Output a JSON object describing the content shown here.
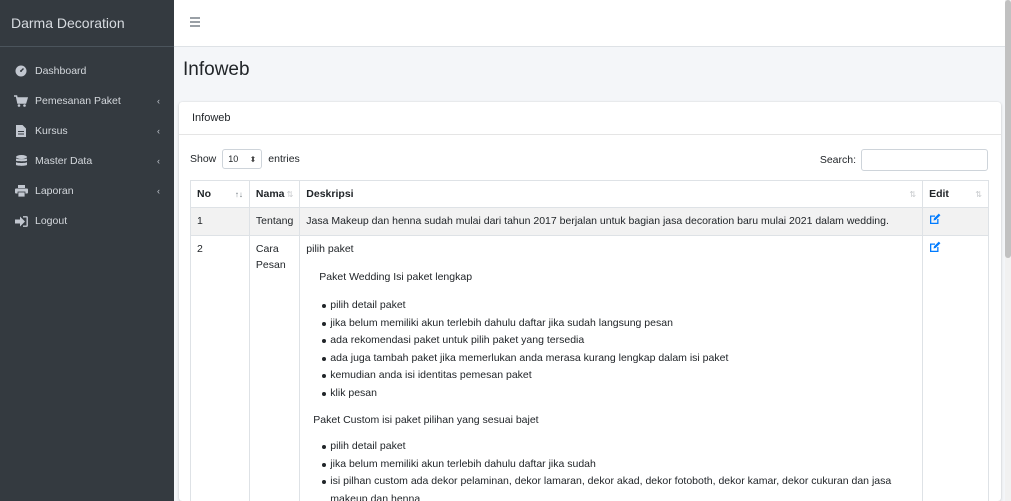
{
  "brand": "Darma Decoration",
  "sidebar": {
    "items": [
      {
        "label": "Dashboard",
        "icon": "tachometer-icon"
      },
      {
        "label": "Pemesanan Paket",
        "icon": "cart-icon",
        "caret": "‹"
      },
      {
        "label": "Kursus",
        "icon": "book-icon",
        "caret": "‹"
      },
      {
        "label": "Master Data",
        "icon": "database-icon",
        "caret": "‹"
      },
      {
        "label": "Laporan",
        "icon": "print-icon",
        "caret": "‹"
      },
      {
        "label": "Logout",
        "icon": "sign-out-icon"
      }
    ]
  },
  "page": {
    "title": "Infoweb"
  },
  "card": {
    "header": "Infoweb",
    "show_label": "Show",
    "entries_value": "10",
    "entries_label": "entries",
    "search_label": "Search:",
    "search_value": ""
  },
  "table": {
    "columns": [
      "No",
      "Nama",
      "Deskripsi",
      "Edit"
    ],
    "rows": [
      {
        "no": "1",
        "nama": "Tentang",
        "deskripsi": "Jasa Makeup dan henna sudah mulai dari tahun 2017 berjalan untuk bagian jasa  decoration baru mulai 2021 dalam wedding."
      },
      {
        "no": "2",
        "nama": "Cara Pesan",
        "intro": "pilih paket",
        "wedding_heading": "Paket Wedding  Isi paket lengkap",
        "wedding_items": [
          "pilih detail paket",
          "jika belum memiliki akun terlebih dahulu daftar jika sudah langsung pesan",
          "ada rekomendasi paket untuk pilih paket yang tersedia",
          "ada juga tambah paket jika memerlukan anda merasa kurang lengkap dalam isi paket",
          "kemudian anda isi identitas pemesan paket",
          "klik pesan"
        ],
        "custom_heading": "Paket Custom isi paket pilihan yang sesuai bajet",
        "custom_items": [
          "pilih detail paket",
          "jika belum memiliki akun terlebih dahulu daftar jika sudah",
          "isi pilhan custom ada dekor pelaminan, dekor lamaran, dekor akad, dekor fotoboth, dekor kamar, dekor cukuran dan jasa makeup dan henna"
        ]
      }
    ]
  },
  "colors": {
    "sidebar_bg": "#343a40",
    "edit_icon": "#007bff",
    "page_bg": "#f4f6f9"
  }
}
